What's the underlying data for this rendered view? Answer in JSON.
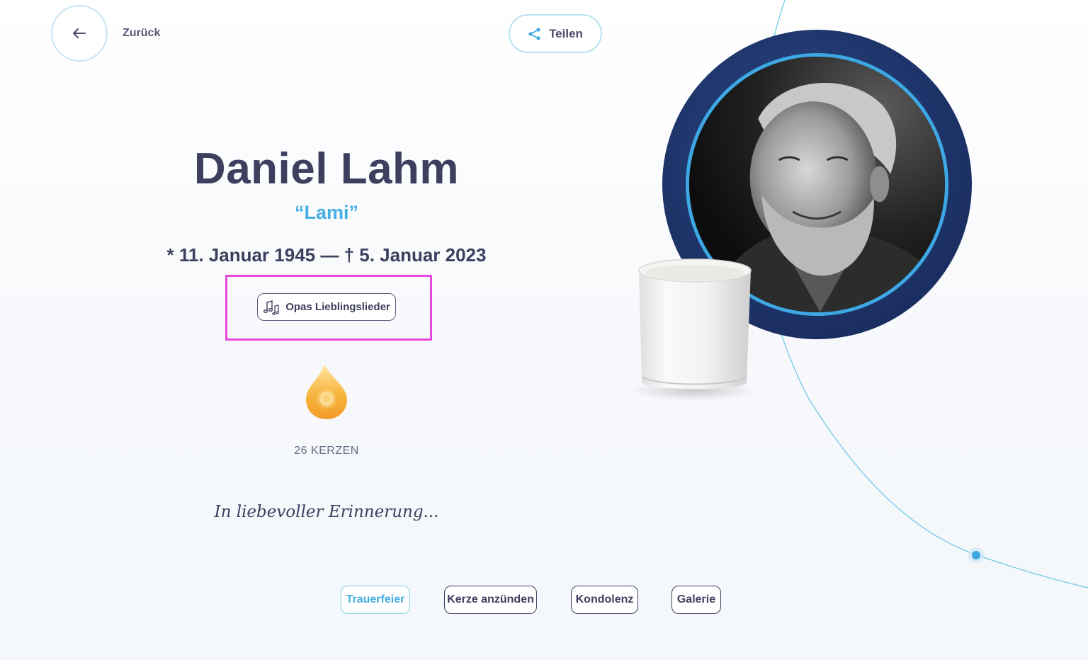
{
  "header": {
    "back_label": "Zurück",
    "share_label": "Teilen"
  },
  "person": {
    "name": "Daniel Lahm",
    "nickname": "“Lami”",
    "dates": "* 11. Januar 1945 — † 5. Januar 2023"
  },
  "music": {
    "label": "Opas Lieblingslieder"
  },
  "candles": {
    "count_label": "26 KERZEN"
  },
  "memory_text": "In liebevoller Erinnerung...",
  "nav": {
    "items": [
      {
        "label": "Trauerfeier",
        "active": true
      },
      {
        "label": "Kerze anzünden",
        "active": false
      },
      {
        "label": "Kondolenz",
        "active": false
      },
      {
        "label": "Galerie",
        "active": false
      }
    ]
  },
  "icons": {
    "back": "arrow-left-icon",
    "share": "share-icon",
    "music": "music-notes-icon",
    "flame": "flame-icon"
  },
  "colors": {
    "accent": "#45aee2",
    "text": "#3e3f5e",
    "highlight": "#e848dc",
    "portrait_bg": "#1e3469",
    "portrait_ring": "#3ea8e4"
  }
}
